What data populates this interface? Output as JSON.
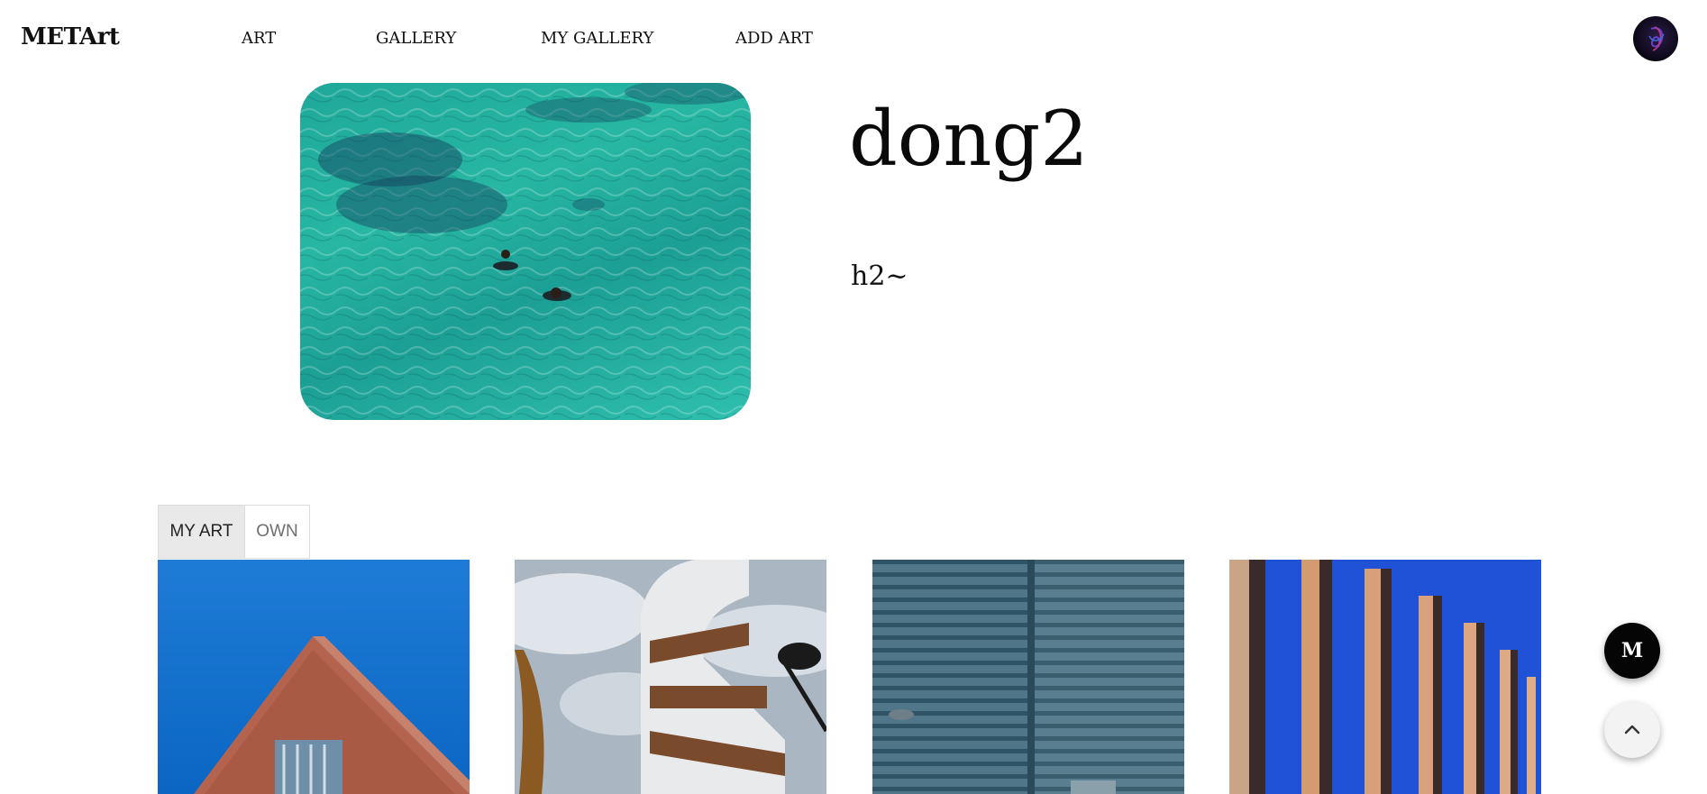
{
  "header": {
    "logo": "METArt",
    "nav": [
      "ART",
      "GALLERY",
      "MY GALLERY",
      "ADD ART"
    ],
    "avatar_icon": "user-avatar-icon"
  },
  "profile": {
    "username": "dong2",
    "bio": "h2~"
  },
  "tabs": {
    "items": [
      "MY ART",
      "OWN"
    ],
    "active": "MY ART"
  },
  "artworks": [
    {
      "subject": "red brick building against blue sky"
    },
    {
      "subject": "curved white apartment tower with cloudy sky"
    },
    {
      "subject": "corrugated teal metal facade"
    },
    {
      "subject": "blue glass facade with orange reflections"
    }
  ],
  "floating": {
    "m_button_label": "M",
    "scroll_top_icon": "chevron-up-icon"
  },
  "colors": {
    "accent": "#000000",
    "tab_active_bg": "#e9e9e9"
  }
}
